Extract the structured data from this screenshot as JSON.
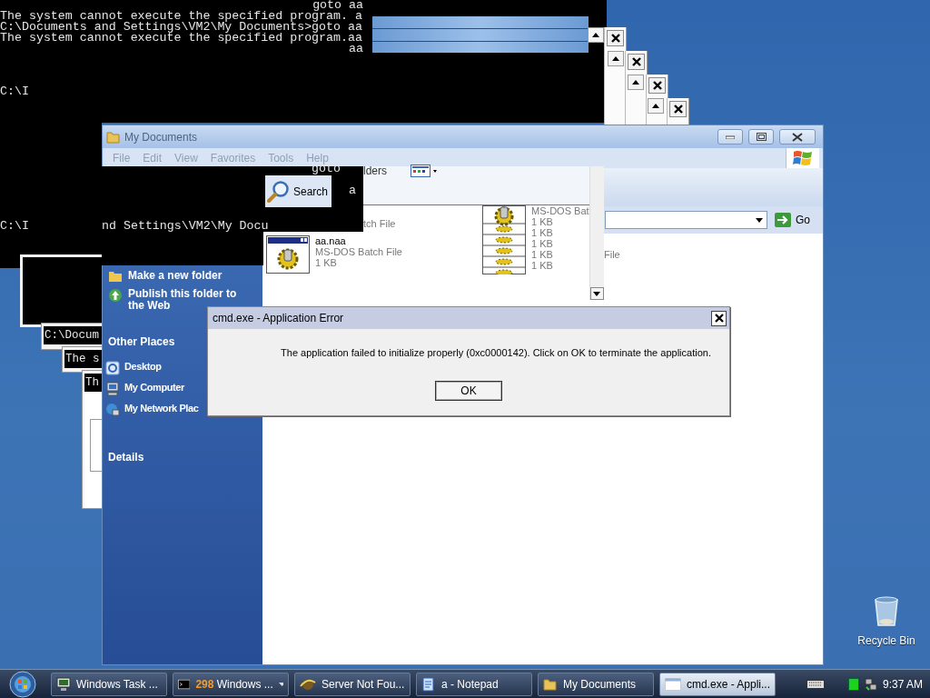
{
  "console": {
    "lines": [
      {
        "text": "goto aa",
        "kind": "tail"
      },
      {
        "text": "The system cannot execute the specified program. a",
        "kind": "line"
      },
      {
        "text": "C:\\Documents and Settings\\VM2\\My Documents>goto aa",
        "kind": "line"
      },
      {
        "text": "The system cannot execute the specified program.aa",
        "kind": "line"
      },
      {
        "text": "aa",
        "kind": "tail"
      }
    ],
    "prompt": "C:\\I"
  },
  "console_fragments": [
    "goto",
    "a",
    "C:\\I",
    "nd Settings\\VM2\\My Docu"
  ],
  "background_windows": [
    {
      "text": "C:\\Docum"
    },
    {
      "text": "The s"
    },
    {
      "text": "Th"
    }
  ],
  "explorer": {
    "title": "My Documents",
    "menu": [
      "File",
      "Edit",
      "View",
      "Favorites",
      "Tools",
      "Help"
    ],
    "toolbar": {
      "search": "Search",
      "fragment": "lders"
    },
    "address": {
      "go": "Go"
    },
    "tasks": [
      {
        "label": "Make a new folder",
        "kind": "folder"
      },
      {
        "label": "Publish this folder to the Web",
        "kind": "publish"
      }
    ],
    "other_places": {
      "title": "Other Places",
      "items": [
        {
          "label": "Desktop",
          "kind": "desktop"
        },
        {
          "label": "My Computer",
          "kind": "computer"
        },
        {
          "label": "My Network Plac",
          "kind": "network"
        }
      ]
    },
    "details": {
      "title": "Details"
    },
    "files": {
      "fragment": "tch File",
      "items": [
        {
          "name": "aa.naa",
          "type": "MS-DOS Batch File",
          "size": "1 KB"
        }
      ],
      "column_2": {
        "type": "MS-DOS Bat",
        "sizes": [
          "1 KB",
          "1 KB",
          "1 KB",
          "1 KB",
          "1 KB"
        ]
      },
      "stray": "File"
    }
  },
  "dialog": {
    "title": "cmd.exe - Application Error",
    "message": "The application failed to initialize properly (0xc0000142). Click on OK to terminate the application.",
    "button": "OK"
  },
  "desktop_icons": [
    {
      "label": "Recycle Bin"
    }
  ],
  "taskbar": {
    "items": [
      {
        "label": "Windows Task ...",
        "kind": "taskmgr",
        "selected": false
      },
      {
        "count": "298",
        "label": "Windows ...",
        "kind": "cmd-group",
        "selected": false
      },
      {
        "label": "Server Not Fou...",
        "kind": "browser",
        "selected": false
      },
      {
        "label": "a - Notepad",
        "kind": "notepad",
        "selected": false
      },
      {
        "label": "My Documents",
        "kind": "folder",
        "selected": false
      },
      {
        "label": "cmd.exe - Appli...",
        "kind": "window",
        "selected": true
      }
    ],
    "clock": "9:37 AM"
  }
}
